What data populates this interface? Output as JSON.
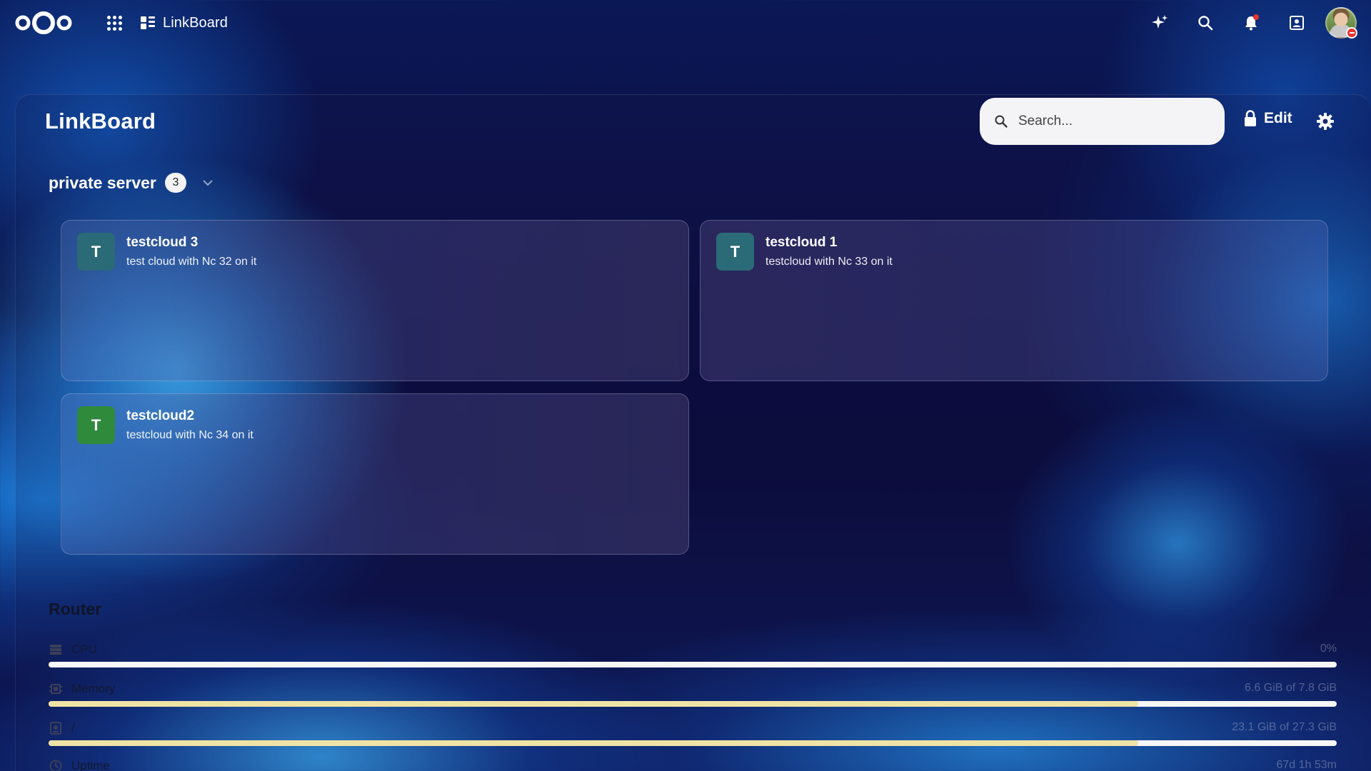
{
  "topbar": {
    "app_name": "LinkBoard",
    "icons": [
      "nextcloud-logo",
      "app-menu-icon",
      "linkboard-icon",
      "assistant-sparkle-icon",
      "search-icon",
      "notifications-icon",
      "contacts-icon",
      "user-avatar"
    ]
  },
  "page": {
    "title": "LinkBoard",
    "search_placeholder": "Search...",
    "edit_label": "Edit"
  },
  "group": {
    "title": "private server",
    "count": "3",
    "items": [
      {
        "letter": "T",
        "title": "testcloud 3",
        "description": "test cloud with Nc 32 on it",
        "color": "#2b6a77"
      },
      {
        "letter": "T",
        "title": "testcloud 1",
        "description": "testcloud with Nc 33 on it",
        "color": "#2b6a77"
      },
      {
        "letter": "T",
        "title": "testcloud2",
        "description": "testcloud with Nc 34 on it",
        "color": "#2f8a3c"
      }
    ]
  },
  "router": {
    "title": "Router",
    "metrics": [
      {
        "label": "CPU",
        "value": "0%",
        "fill_percent": 0,
        "icon": "cpu-icon"
      },
      {
        "label": "Memory",
        "value": "6.6 GiB of 7.8 GiB",
        "fill_percent": 84.6,
        "icon": "memory-icon"
      },
      {
        "label": "/",
        "value": "23.1 GiB of 27.3 GiB",
        "fill_percent": 84.6,
        "icon": "disk-icon"
      },
      {
        "label": "Uptime",
        "value": "67d 1h 53m",
        "icon": "clock-icon"
      }
    ]
  },
  "colors": {
    "accent_teal": "#2b6a77",
    "accent_green": "#2f8a3c",
    "notification_red": "#e9322d",
    "bar_fill": "#efe3a6"
  }
}
